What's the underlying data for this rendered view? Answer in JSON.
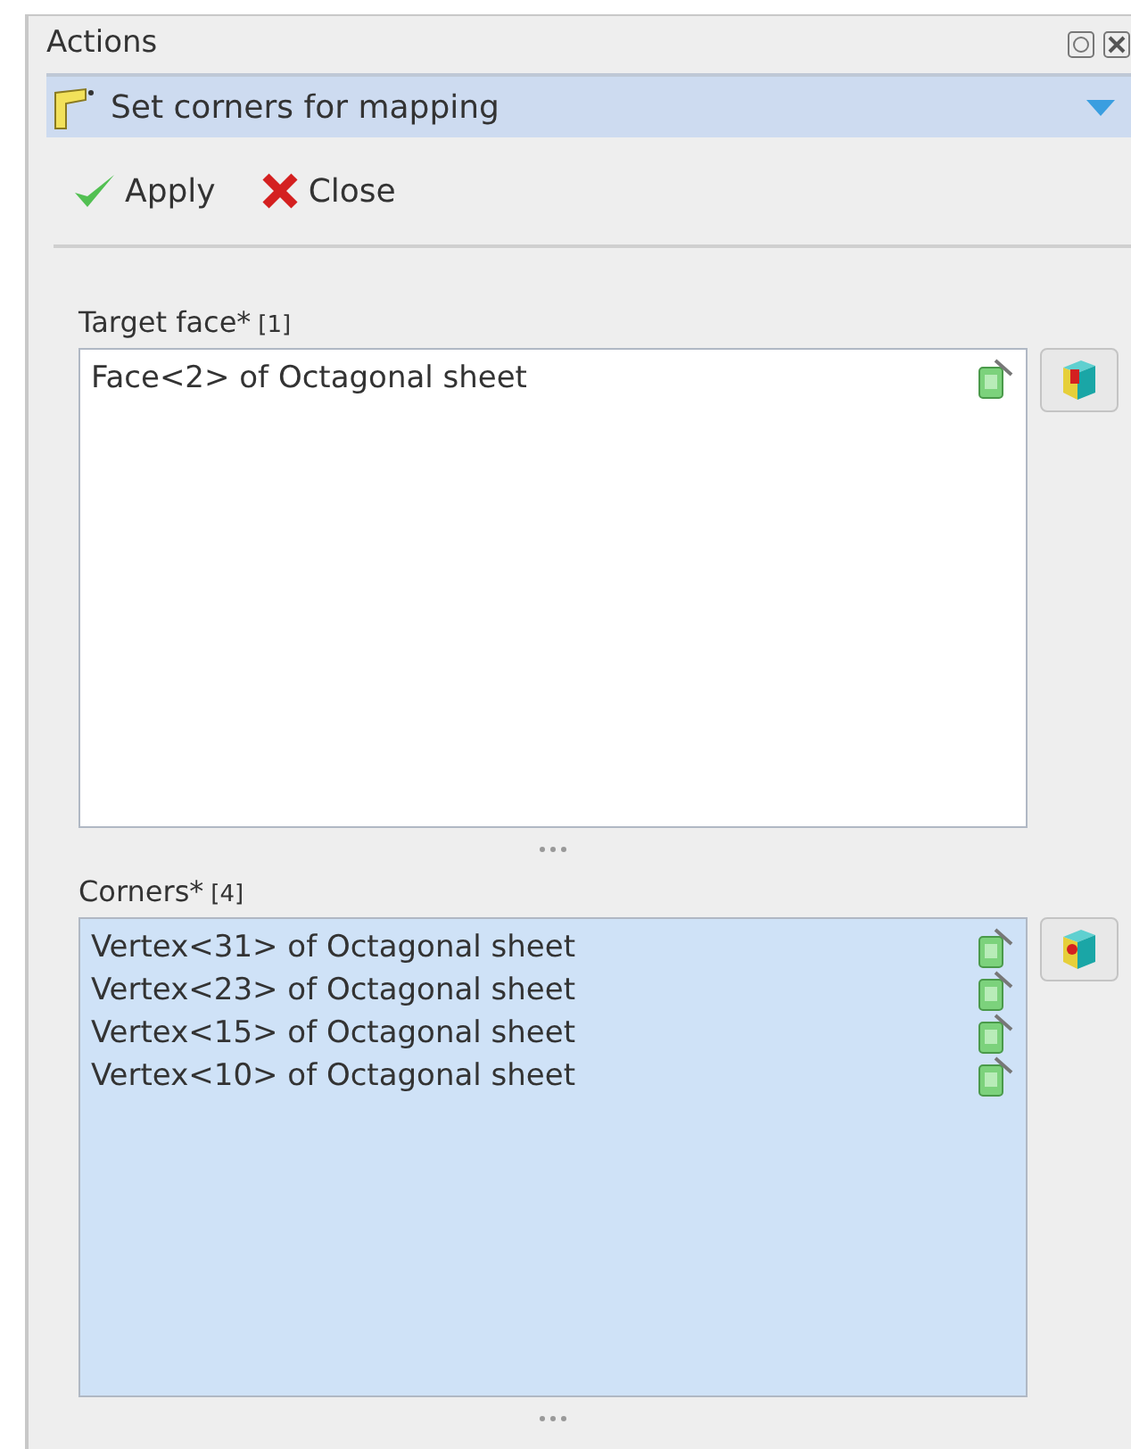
{
  "panel": {
    "title": "Actions"
  },
  "task": {
    "title": "Set corners for mapping",
    "expanded": true
  },
  "buttons": [
    {
      "kind": "apply",
      "label": "Apply"
    },
    {
      "kind": "close",
      "label": "Close"
    }
  ],
  "sections": [
    {
      "label": "Target face*",
      "count": "[1]",
      "active": false,
      "items": [
        "Face<2> of Octagonal sheet"
      ]
    },
    {
      "label": "Corners*",
      "count": "[4]",
      "active": true,
      "items": [
        "Vertex<31> of Octagonal sheet",
        "Vertex<23> of Octagonal sheet",
        "Vertex<15> of Octagonal sheet",
        "Vertex<10> of Octagonal sheet"
      ]
    }
  ]
}
